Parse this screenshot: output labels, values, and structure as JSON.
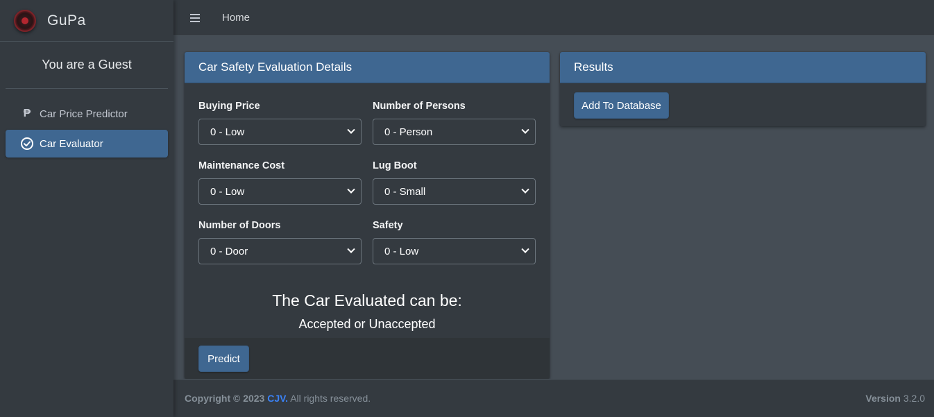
{
  "app": {
    "brand": "GuPa"
  },
  "sidebar": {
    "user": "You are a Guest",
    "items": [
      {
        "label": "Car Price Predictor",
        "icon": "peso-icon",
        "active": false
      },
      {
        "label": "Car Evaluator",
        "icon": "check-circle-icon",
        "active": true
      }
    ]
  },
  "navbar": {
    "home": "Home"
  },
  "details_card": {
    "title": "Car Safety Evaluation Details",
    "fields": {
      "buying_price": {
        "label": "Buying Price",
        "value": "0 - Low"
      },
      "persons": {
        "label": "Number of Persons",
        "value": "0 - Person"
      },
      "maintenance": {
        "label": "Maintenance Cost",
        "value": "0 - Low"
      },
      "lug_boot": {
        "label": "Lug Boot",
        "value": "0 - Small"
      },
      "doors": {
        "label": "Number of Doors",
        "value": "0 - Door"
      },
      "safety": {
        "label": "Safety",
        "value": "0 - Low"
      }
    },
    "result_title": "The Car Evaluated can be:",
    "result_value": "Accepted or Unaccepted",
    "predict_label": "Predict"
  },
  "results_card": {
    "title": "Results",
    "add_label": "Add To Database"
  },
  "footer": {
    "copyright_prefix": "Copyright © 2023",
    "brand": "CJV.",
    "rights": "All rights reserved.",
    "version_label": "Version",
    "version": "3.2.0"
  },
  "colors": {
    "primary": "#3f6791",
    "sidebar_bg": "#343a40",
    "content_bg": "#454d55",
    "link": "#3b82f6"
  }
}
